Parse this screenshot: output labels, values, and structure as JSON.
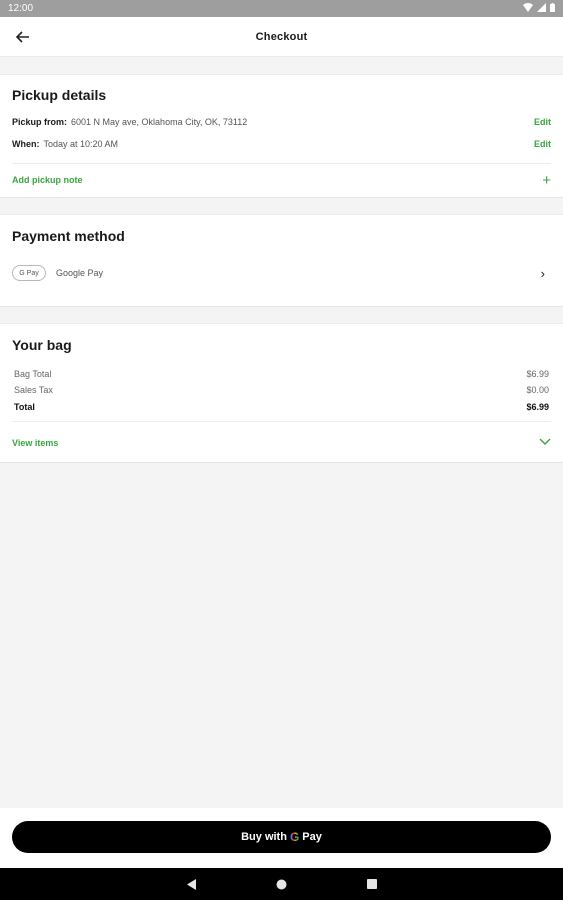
{
  "status_bar": {
    "time": "12:00"
  },
  "app_bar": {
    "title": "Checkout"
  },
  "pickup": {
    "title": "Pickup details",
    "from_label": "Pickup from:",
    "from_value": "6001 N May ave, Oklahoma City, OK, 73112",
    "when_label": "When:",
    "when_value": "Today at 10:20 AM",
    "edit_label": "Edit",
    "add_note_label": "Add pickup note",
    "add_icon": "plus-icon"
  },
  "payment": {
    "title": "Payment method",
    "badge_text": "G Pay",
    "method_label": "Google Pay",
    "chevron_icon": "chevron-right-icon"
  },
  "bag": {
    "title": "Your bag",
    "rows": [
      {
        "label": "Bag Total",
        "value": "$6.99"
      },
      {
        "label": "Sales Tax",
        "value": "$0.00"
      },
      {
        "label": "Total",
        "value": "$6.99"
      }
    ],
    "view_items_label": "View items",
    "expand_icon": "chevron-down-icon"
  },
  "footer": {
    "buy_prefix": "Buy with",
    "buy_g": "G",
    "buy_suffix": "Pay"
  },
  "colors": {
    "accent": "#3aa540",
    "status_bar": "#9e9e9e",
    "background": "#f4f4f4",
    "button": "#000000"
  }
}
